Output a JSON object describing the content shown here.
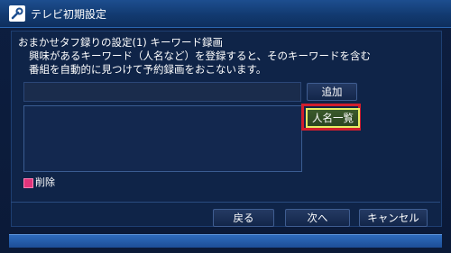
{
  "window": {
    "title": "テレビ初期設定",
    "icon": "wrench-icon"
  },
  "description": {
    "line1": "おまかせタフ録りの設定(1) キーワード録画",
    "line2": "興味があるキーワード（人名など）を登録すると、そのキーワードを含む",
    "line3": "番組を自動的に見つけて予約録画をおこないます。"
  },
  "keyword_input": {
    "value": ""
  },
  "buttons": {
    "add": "追加",
    "name_list": "人名一覧",
    "back": "戻る",
    "next": "次へ",
    "cancel": "キャンセル"
  },
  "delete": {
    "label": "削除",
    "color": "#e0347b"
  },
  "colors": {
    "highlight": "#d11e2d",
    "focus": "#e6ef64",
    "accent": "#2e6bbd"
  }
}
